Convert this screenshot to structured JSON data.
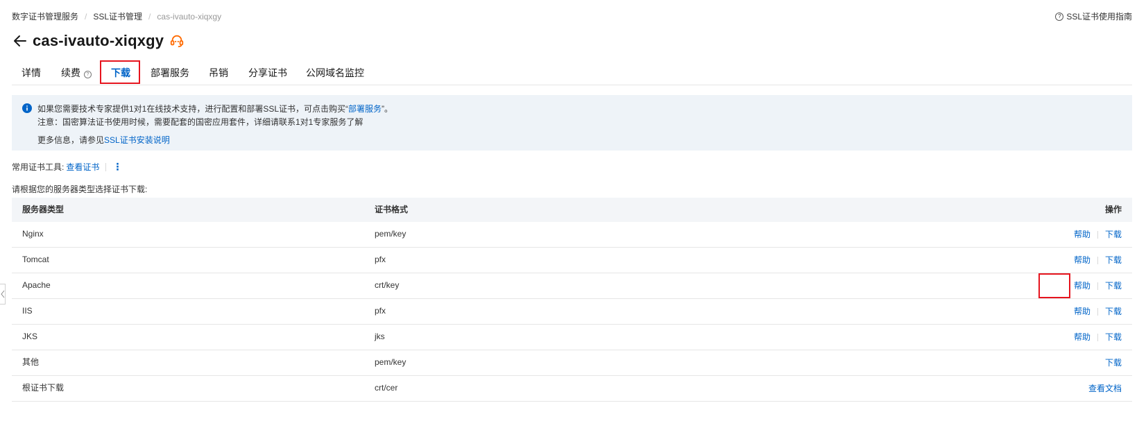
{
  "breadcrumb": {
    "items": [
      "数字证书管理服务",
      "SSL证书管理"
    ],
    "current": "cas-ivauto-xiqxgy"
  },
  "header": {
    "guide_link": "SSL证书使用指南",
    "title": "cas-ivauto-xiqxgy"
  },
  "tabs": [
    {
      "label": "详情"
    },
    {
      "label": "续费"
    },
    {
      "label": "下载",
      "active": true
    },
    {
      "label": "部署服务"
    },
    {
      "label": "吊销"
    },
    {
      "label": "分享证书"
    },
    {
      "label": "公网域名监控"
    }
  ],
  "notice": {
    "line1_prefix": "如果您需要技术专家提供1对1在线技术支持，进行配置和部署SSL证书，可点击购买“",
    "line1_link": "部署服务",
    "line1_suffix": "”。",
    "line2": "注意：国密算法证书使用时候，需要配套的国密应用套件，详细请联系1对1专家服务了解",
    "line3_prefix": "更多信息，请参见",
    "line3_link": "SSL证书安装说明"
  },
  "tools": {
    "label": "常用证书工具:",
    "link": "查看证书"
  },
  "select_hint": "请根据您的服务器类型选择证书下载:",
  "table": {
    "headers": [
      "服务器类型",
      "证书格式",
      "操作"
    ],
    "rows": [
      {
        "type": "Nginx",
        "format": "pem/key",
        "help": "帮助",
        "download": "下载"
      },
      {
        "type": "Tomcat",
        "format": "pfx",
        "help": "帮助",
        "download": "下载"
      },
      {
        "type": "Apache",
        "format": "crt/key",
        "help": "帮助",
        "download": "下载"
      },
      {
        "type": "IIS",
        "format": "pfx",
        "help": "帮助",
        "download": "下载"
      },
      {
        "type": "JKS",
        "format": "jks",
        "help": "帮助",
        "download": "下载"
      },
      {
        "type": "其他",
        "format": "pem/key",
        "download": "下载"
      },
      {
        "type": "根证书下载",
        "format": "crt/cer",
        "docs": "查看文档"
      }
    ]
  },
  "colors": {
    "link": "#0064c8",
    "highlight": "#e6141e",
    "support_icon": "#ff6a00",
    "notice_bg": "#eef3f8"
  },
  "icons": {
    "back": "arrow-left-icon",
    "support": "headset-icon",
    "guide": "question-circle-icon",
    "info": "info-circle-icon",
    "more": "more-vertical-icon"
  }
}
